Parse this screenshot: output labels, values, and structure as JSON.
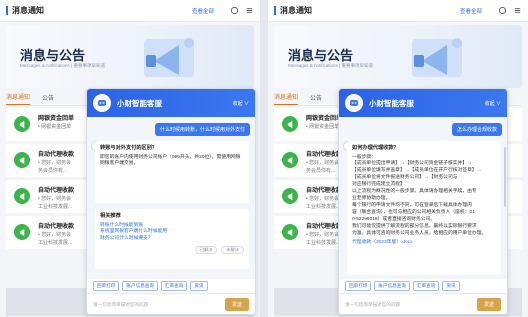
{
  "left": {
    "header": {
      "title": "消息通知",
      "link": "查看全部"
    },
    "banner": {
      "title": "消息与公告",
      "subtitle": "Messages & notifications | 重要事项早知道"
    },
    "tabs": [
      {
        "label": "消息通知"
      },
      {
        "label": "公告"
      }
    ],
    "items": [
      {
        "title": "网银资金回单",
        "d1": "• 网银资金回单",
        "d2": ""
      },
      {
        "title": "自动代理收款",
        "d1": "• 您好，财务会",
        "d2": "  务会员你有..."
      },
      {
        "title": "自动代理收款",
        "d1": "• 您好，财务会",
        "d2": "  工业科技发展..."
      },
      {
        "title": "自动代理收款",
        "d1": "• 您好，财务会",
        "d2": "  工业科技发展..."
      }
    ],
    "chat": {
      "name": "小财智能客服",
      "menu": "收起 ∨",
      "user_msg": "什么时候用转账，什么时候用对外支付",
      "answer_title": "转账与对外支付的区别？",
      "answer_text": "即您的账户内使用财务公司账户（999开头，共20位），需使用网银网银客户端交易。",
      "related_title": "相关推荐",
      "related": [
        "转账什么时候能到账",
        "系统里网银客户端什么时候能用",
        "财务公司什么时候要支？"
      ],
      "fb_yes": "已解决",
      "fb_no": "未解决",
      "quick": [
        "回单打印",
        "账户信息查询",
        "汇率查询",
        "资讯"
      ],
      "placeholder": "请一句话简单描述您的问题",
      "send": "发送"
    }
  },
  "right": {
    "header": {
      "title": "消息通知",
      "link": "查看全部"
    },
    "banner": {
      "title": "消息与公告",
      "subtitle": "Messages & notifications | 重要事项早知道"
    },
    "tabs": [
      {
        "label": "消息通知"
      },
      {
        "label": "公告"
      }
    ],
    "items": [
      {
        "title": "网银资金回单",
        "d1": "• 网银资金回单",
        "d2": ""
      },
      {
        "title": "自动代理收款",
        "d1": "• 您好，财务会",
        "d2": "  务会员你有..."
      },
      {
        "title": "自动代理收款",
        "d1": "• 您好，财务会",
        "d2": "  工业科技发展..."
      },
      {
        "title": "自动代理收款",
        "d1": "• 您好，财务会",
        "d2": "  工业科技发展..."
      }
    ],
    "chat": {
      "name": "小财智能客服",
      "menu": "收起 ∨",
      "user_msg": "怎么办理合规收款",
      "answer_title": "如何办理代理收款？",
      "lines": [
        "一般步骤：",
        "【成员单位提出申请】→【财务公司资金链子核实并】→",
        "【成员单位填写并盖章】→【成员单位在开户行核对签章】→",
        "【成员单位将文件报送财务公司】→【财务公司与",
        "对应银行完成建立流程】",
        "以上流程为概况性的一般步骤。具体请办理相关手续，由专",
        "业老师协助办理。",
        "每个银行的申请文件均不同，可在登录后下载具体办理内",
        "容（联合查询），也可与相应的公司相关负责人（座机：01",
        "0-52296018）或者直接咨询财务公司。",
        "我们可能仅提供了解流程的部分信息，最终以实际银行要求",
        "为准，具体可咨询财务公司业务人员，给相应的用户单位办理。"
      ],
      "attachment": "代理收款（2023年版）.docx",
      "quick": [
        "回单打印",
        "账户信息查询",
        "汇率查询",
        "资讯"
      ],
      "placeholder": "请一句话简单描述您的问题",
      "send": "发送"
    }
  },
  "colors": {
    "accent": "#2f6fe6",
    "tab_active": "#d2731f",
    "badge": "#39b54a",
    "send": "#d9a34a"
  }
}
